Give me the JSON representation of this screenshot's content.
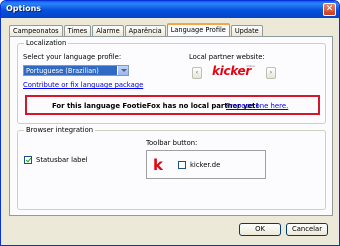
{
  "window": {
    "title": "Options"
  },
  "tabs": [
    {
      "label": "Campeonatos",
      "active": false
    },
    {
      "label": "Times",
      "active": false
    },
    {
      "label": "Alarme",
      "active": false
    },
    {
      "label": "Aparência",
      "active": false
    },
    {
      "label": "Language Profile",
      "active": true
    },
    {
      "label": "Update",
      "active": false
    }
  ],
  "localization": {
    "group_title": "Localization",
    "select_label": "Select your language profile:",
    "selected_language": "Portuguese (Brazilian)",
    "contribute_link": "Contribute or fix language package",
    "partner_label": "Local partner website:",
    "partner_logo_text": "kicker",
    "partner_logo_tag": "online",
    "alert_message": "For this language FootieFox has no local partner yet!",
    "alert_link": "Propose one here."
  },
  "browser_integration": {
    "group_title": "Browser integration",
    "statusbar_label": "Statusbar label",
    "statusbar_checked": true,
    "toolbar_label": "Toolbar button:",
    "toolbar_icon_letter": "k",
    "toolbar_item_label": "kicker.de",
    "toolbar_item_checked": false
  },
  "footer": {
    "ok": "OK",
    "cancel": "Cancelar"
  },
  "colors": {
    "accent": "#e30613",
    "titlebar": "#0550dc",
    "alert_border": "#d4172a"
  }
}
